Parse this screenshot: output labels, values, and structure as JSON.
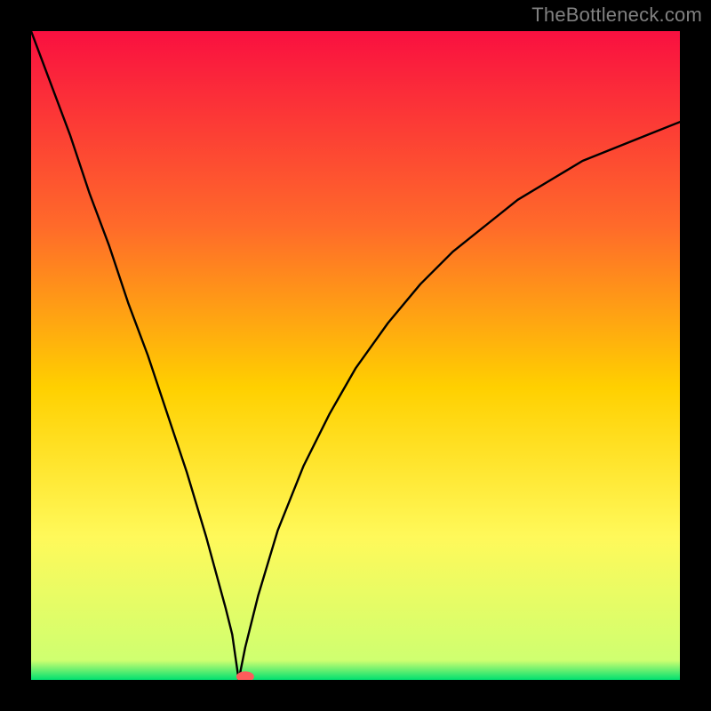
{
  "attribution": "TheBottleneck.com",
  "palette": {
    "top": "#f91040",
    "mid1": "#ff6a2a",
    "mid2": "#ffd000",
    "mid3": "#fff95a",
    "bottom": "#00e070",
    "curve": "#000000",
    "marker": "#ff5b5b",
    "frame": "#000000"
  },
  "chart_data": {
    "type": "line",
    "title": "",
    "xlabel": "",
    "ylabel": "",
    "xlim": [
      0,
      100
    ],
    "ylim": [
      0,
      100
    ],
    "grid": false,
    "legend": false,
    "notch_x": 32,
    "marker": {
      "x": 33,
      "y": 0.5
    },
    "series": [
      {
        "name": "bottleneck-curve",
        "x": [
          0,
          3,
          6,
          9,
          12,
          15,
          18,
          21,
          24,
          27,
          30,
          31,
          32,
          33,
          34,
          35,
          38,
          42,
          46,
          50,
          55,
          60,
          65,
          70,
          75,
          80,
          85,
          90,
          95,
          100
        ],
        "y": [
          100,
          92,
          84,
          75,
          67,
          58,
          50,
          41,
          32,
          22,
          11,
          7,
          0,
          5,
          9,
          13,
          23,
          33,
          41,
          48,
          55,
          61,
          66,
          70,
          74,
          77,
          80,
          82,
          84,
          86
        ]
      }
    ],
    "background_gradient": {
      "direction": "vertical",
      "stops": [
        {
          "offset": 0.0,
          "color": "#f91040"
        },
        {
          "offset": 0.3,
          "color": "#ff6a2a"
        },
        {
          "offset": 0.55,
          "color": "#ffd000"
        },
        {
          "offset": 0.78,
          "color": "#fff95a"
        },
        {
          "offset": 0.97,
          "color": "#cfff70"
        },
        {
          "offset": 1.0,
          "color": "#00e070"
        }
      ]
    }
  }
}
